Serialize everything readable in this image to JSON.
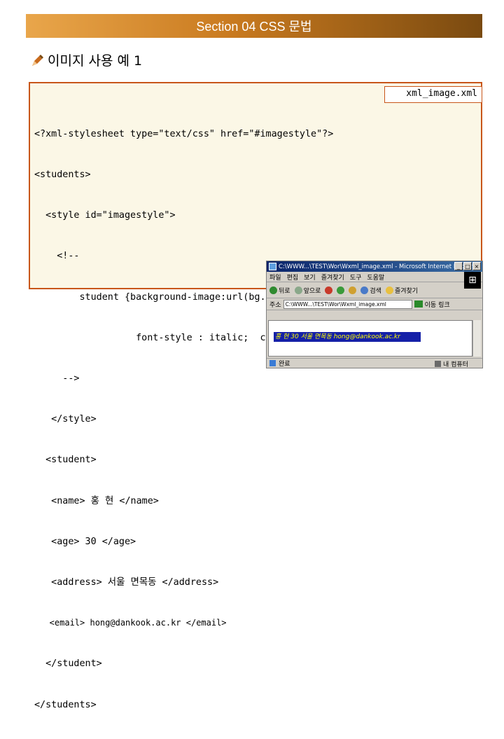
{
  "header": {
    "title": "Section 04 CSS 문법"
  },
  "slide": {
    "title": "이미지 사용 예 1"
  },
  "code": {
    "filename": "xml_image.xml",
    "lines": [
      "<?xml-stylesheet type=\"text/css\" href=\"#imagestyle\"?>",
      "<students>",
      "  <style id=\"imagestyle\">",
      "    <!--",
      "        student {background-image:url(bg.gif);",
      "                  font-style : italic;  color : yellow}",
      "     -->",
      "   </style>",
      "  <student>",
      "   <name> 홍 현 </name>",
      "   <age> 30 </age>",
      "   <address> 서울 면목동 </address>",
      "   <email> hong@dankook.ac.kr </email>",
      "  </student>",
      "</students>"
    ]
  },
  "browser": {
    "title": "C:\\WWW...\\TEST\\Wor\\Wxml_image.xml - Microsoft Internet Explorer",
    "menu": [
      "파일",
      "편집",
      "보기",
      "즐겨찾기",
      "도구",
      "도움말"
    ],
    "toolbar": {
      "back": "뒤로",
      "forward": "앞으로",
      "search": "검색",
      "favorites": "즐겨찾기"
    },
    "address_label": "주소",
    "address_value": "C:\\WWW...\\TEST\\Wor\\Wxml_image.xml",
    "go_label": "이동",
    "links_label": "링크",
    "rendered_text": "홍 현 30 서울 면목동 hong@dankook.ac.kr",
    "status_left": "완료",
    "status_right": "내 컴퓨터",
    "colors": {
      "content_bg": "#1520a8",
      "content_text": "#ffff00"
    }
  },
  "colors": {
    "header_start": "#e9a64b",
    "header_end": "#7a4a10",
    "panel_border": "#c8561a",
    "panel_bg": "#fbf7e6"
  }
}
